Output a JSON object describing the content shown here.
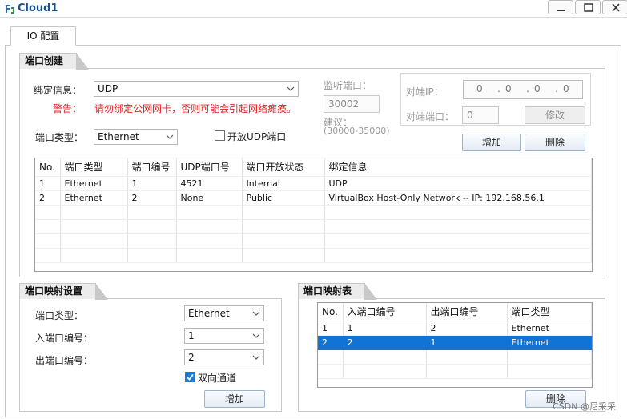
{
  "window": {
    "title": "Cloud1",
    "controls": {
      "minimize": "_",
      "maximize": "□",
      "close": "X"
    }
  },
  "tab": {
    "label": "IO 配置"
  },
  "port_creation": {
    "header": "端口创建",
    "bind_label": "绑定信息：",
    "bind_value": "UDP",
    "warning_label": "警告：",
    "warning_text": "请勿绑定公网网卡，否则可能会引起网络瘫痪。",
    "port_type_label": "端口类型：",
    "port_type_value": "Ethernet",
    "open_udp_label": "开放UDP端口",
    "listen_port_label": "监听端口：",
    "listen_port_value": "30002",
    "suggest_label": "建议：",
    "suggest_range": "(30000-35000)",
    "peer_ip_label": "对端IP：",
    "peer_ip_value": [
      "0",
      "0",
      "0",
      "0"
    ],
    "peer_port_label": "对端端口：",
    "peer_port_value": "0",
    "modify_button": "修改",
    "add_button": "增加",
    "delete_button": "删除",
    "table": {
      "columns": [
        "No.",
        "端口类型",
        "端口编号",
        "UDP端口号",
        "端口开放状态",
        "绑定信息"
      ],
      "rows": [
        [
          "1",
          "Ethernet",
          "1",
          "4521",
          "Internal",
          "UDP"
        ],
        [
          "2",
          "Ethernet",
          "2",
          "None",
          "Public",
          "VirtualBox Host-Only Network -- IP: 192.168.56.1"
        ]
      ]
    }
  },
  "port_mapping_settings": {
    "header": "端口映射设置",
    "port_type_label": "端口类型：",
    "port_type_value": "Ethernet",
    "in_port_label": "入端口编号：",
    "in_port_value": "1",
    "out_port_label": "出端口编号：",
    "out_port_value": "2",
    "bidirectional_label": "双向通道",
    "add_button": "增加"
  },
  "port_mapping_table": {
    "header": "端口映射表",
    "columns": [
      "No.",
      "入端口编号",
      "出端口编号",
      "端口类型"
    ],
    "rows": [
      [
        "1",
        "1",
        "2",
        "Ethernet"
      ],
      [
        "2",
        "2",
        "1",
        "Ethernet"
      ]
    ],
    "delete_button": "删除"
  },
  "watermark": "CSDN @尼采采",
  "colors": {
    "selection": "#1173d4",
    "warning": "#e02020",
    "title": "#1a4e8a"
  }
}
